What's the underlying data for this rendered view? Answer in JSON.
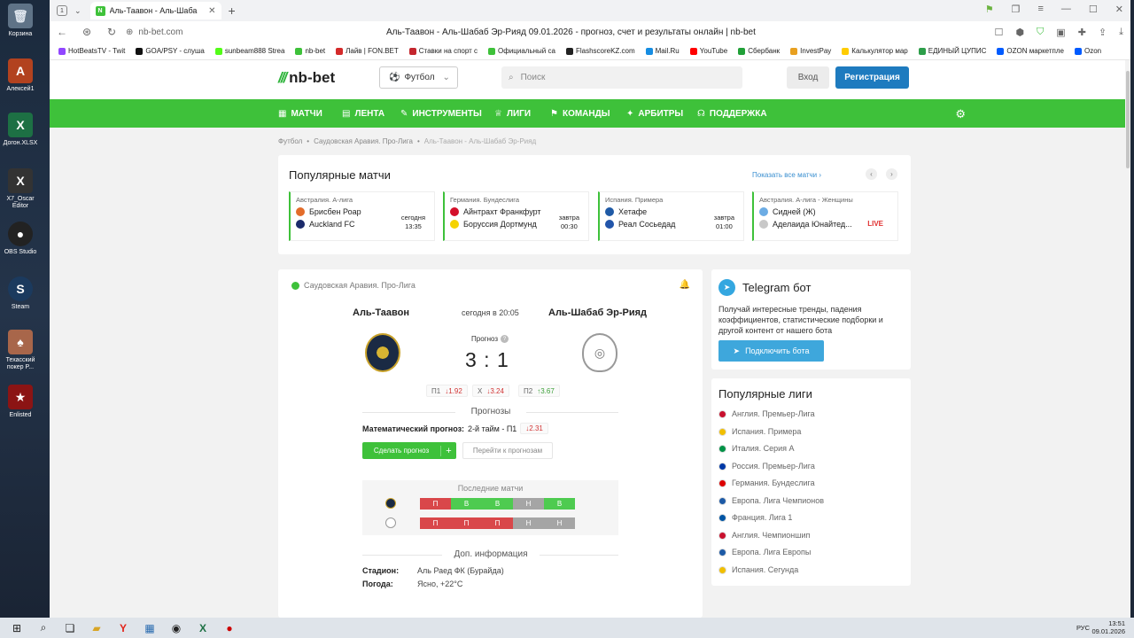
{
  "desktop": {
    "icons": [
      {
        "label": "Корзина",
        "glyph": "🗑"
      },
      {
        "label": "Алексей1",
        "glyph": "A"
      },
      {
        "label": "Догон.XLSX",
        "glyph": "X"
      },
      {
        "label": "X7_Oscar Editor",
        "glyph": "X"
      },
      {
        "label": "OBS Studio",
        "glyph": "●"
      },
      {
        "label": "Steam",
        "glyph": "S"
      },
      {
        "label": "Техасский покер P...",
        "glyph": "♠"
      },
      {
        "label": "Enlisted",
        "glyph": "★"
      }
    ]
  },
  "browser": {
    "tab_count": "1",
    "tab_title": "Аль-Таавон - Аль-Шаба",
    "url": "nb-bet.com",
    "page_title": "Аль-Таавон - Аль-Шабаб Эр-Рияд 09.01.2026 - прогноз, счет и результаты онлайн | nb-bet",
    "bookmarks": [
      {
        "label": "HotBeatsTV - Twit",
        "color": "#9146ff"
      },
      {
        "label": "GOA/PSY - слуша",
        "color": "#111111"
      },
      {
        "label": "sunbeam888 Strea",
        "color": "#53fc18"
      },
      {
        "label": "nb-bet",
        "color": "#3ec13a"
      },
      {
        "label": "Лайв | FON.BET",
        "color": "#d42a2a"
      },
      {
        "label": "Ставки на спорт с",
        "color": "#c4262e"
      },
      {
        "label": "Официальный са",
        "color": "#3ec13a"
      },
      {
        "label": "FlashscoreKZ.com",
        "color": "#222222"
      },
      {
        "label": "Mail.Ru",
        "color": "#168de2"
      },
      {
        "label": "YouTube",
        "color": "#ff0000"
      },
      {
        "label": "Сбербанк",
        "color": "#21a038"
      },
      {
        "label": "InvestPay",
        "color": "#e8a020"
      },
      {
        "label": "Калькулятор мар",
        "color": "#ffcc00"
      },
      {
        "label": "ЕДИНЫЙ ЦУПИС",
        "color": "#2d9e4a"
      },
      {
        "label": "OZON маркетпле",
        "color": "#005bff"
      },
      {
        "label": "Ozon",
        "color": "#005bff"
      }
    ]
  },
  "site": {
    "logo": "nb-bet",
    "sport_select": "Футбол",
    "search_placeholder": "Поиск",
    "login": "Вход",
    "register": "Регистрация",
    "nav": [
      {
        "label": "МАТЧИ",
        "glyph": "▦"
      },
      {
        "label": "ЛЕНТА",
        "glyph": "▤"
      },
      {
        "label": "ИНСТРУМЕНТЫ",
        "glyph": "✎"
      },
      {
        "label": "ЛИГИ",
        "glyph": "♕"
      },
      {
        "label": "КОМАНДЫ",
        "glyph": "⚑"
      },
      {
        "label": "АРБИТРЫ",
        "glyph": "✦"
      },
      {
        "label": "ПОДДЕРЖКА",
        "glyph": "☊"
      }
    ],
    "breadcrumb": [
      "Футбол",
      "Саудовская Аравия. Про-Лига",
      "Аль-Таавон - Аль-Шабаб Эр-Рияд"
    ]
  },
  "popular": {
    "title": "Популярные матчи",
    "show_all": "Показать все матчи ›",
    "matches": [
      {
        "league": "Австралия. А-лига",
        "home": "Брисбен Роар",
        "away": "Auckland FC",
        "day": "сегодня",
        "time": "13:35",
        "home_color": "#e36c2a",
        "away_color": "#1b2a6b",
        "live": ""
      },
      {
        "league": "Германия. Бундеслига",
        "home": "Айнтрахт Франкфурт",
        "away": "Боруссия Дортмунд",
        "day": "завтра",
        "time": "00:30",
        "home_color": "#d4102a",
        "away_color": "#f5d300",
        "live": ""
      },
      {
        "league": "Испания. Примера",
        "home": "Хетафе",
        "away": "Реал Сосьедад",
        "day": "завтра",
        "time": "01:00",
        "home_color": "#1f5aa6",
        "away_color": "#2255aa",
        "live": ""
      },
      {
        "league": "Австралия. А-лига - Женщины",
        "home": "Сидней (Ж)",
        "away": "Аделаида Юнайтед...",
        "day": "",
        "time": "",
        "home_color": "#6cace4",
        "away_color": "#c8c8c8",
        "live": "LIVE"
      }
    ]
  },
  "match": {
    "league": "Саудовская Аравия. Про-Лига",
    "home": "Аль-Таавон",
    "away": "Аль-Шабаб Эр-Рияд",
    "time": "сегодня в 20:05",
    "prognoz_label": "Прогноз",
    "score": "3 : 1",
    "odds": [
      {
        "label": "П1",
        "arrow": "↓",
        "value": "1.92",
        "dir": "down"
      },
      {
        "label": "X",
        "arrow": "↓",
        "value": "3.24",
        "dir": "down"
      },
      {
        "label": "П2",
        "arrow": "↑",
        "value": "3.67",
        "dir": "up"
      }
    ],
    "forecasts_title": "Прогнозы",
    "math_label": "Математический прогноз:",
    "math_value": "2-й тайм - П1",
    "math_odd": "↓2.31",
    "make_btn": "Сделать прогноз",
    "goto_btn": "Перейти к прогнозам",
    "last_title": "Последние матчи",
    "form_home": [
      {
        "r": "П",
        "t": "l"
      },
      {
        "r": "В",
        "t": "w"
      },
      {
        "r": "В",
        "t": "w"
      },
      {
        "r": "Н",
        "t": "d"
      },
      {
        "r": "В",
        "t": "w"
      }
    ],
    "form_away": [
      {
        "r": "П",
        "t": "l"
      },
      {
        "r": "П",
        "t": "l"
      },
      {
        "r": "П",
        "t": "l"
      },
      {
        "r": "Н",
        "t": "d"
      },
      {
        "r": "Н",
        "t": "d"
      }
    ],
    "extra_title": "Доп. информация",
    "stadium_label": "Стадион:",
    "stadium": "Аль Раед ФК (Бурайда)",
    "weather_label": "Погода:",
    "weather": "Ясно, +22°C"
  },
  "telegram": {
    "title": "Telegram бот",
    "text": "Получай интересные тренды, падения коэффициентов, статистические подборки и другой контент от нашего бота",
    "button": "Подключить бота"
  },
  "leagues": {
    "title": "Популярные лиги",
    "items": [
      {
        "label": "Англия. Премьер-Лига",
        "color": "#c8102e"
      },
      {
        "label": "Испания. Примера",
        "color": "#f1bf00"
      },
      {
        "label": "Италия. Серия А",
        "color": "#009246"
      },
      {
        "label": "Россия. Премьер-Лига",
        "color": "#0039a6"
      },
      {
        "label": "Германия. Бундеслига",
        "color": "#dd0000"
      },
      {
        "label": "Европа. Лига Чемпионов",
        "color": "#1d5aa6"
      },
      {
        "label": "Франция. Лига 1",
        "color": "#0055a4"
      },
      {
        "label": "Англия. Чемпионшип",
        "color": "#c8102e"
      },
      {
        "label": "Европа. Лига Европы",
        "color": "#1d5aa6"
      },
      {
        "label": "Испания. Сегунда",
        "color": "#f1bf00"
      }
    ]
  },
  "taskbar": {
    "lang": "РУС",
    "time": "13:51",
    "date": "09.01.2026"
  }
}
